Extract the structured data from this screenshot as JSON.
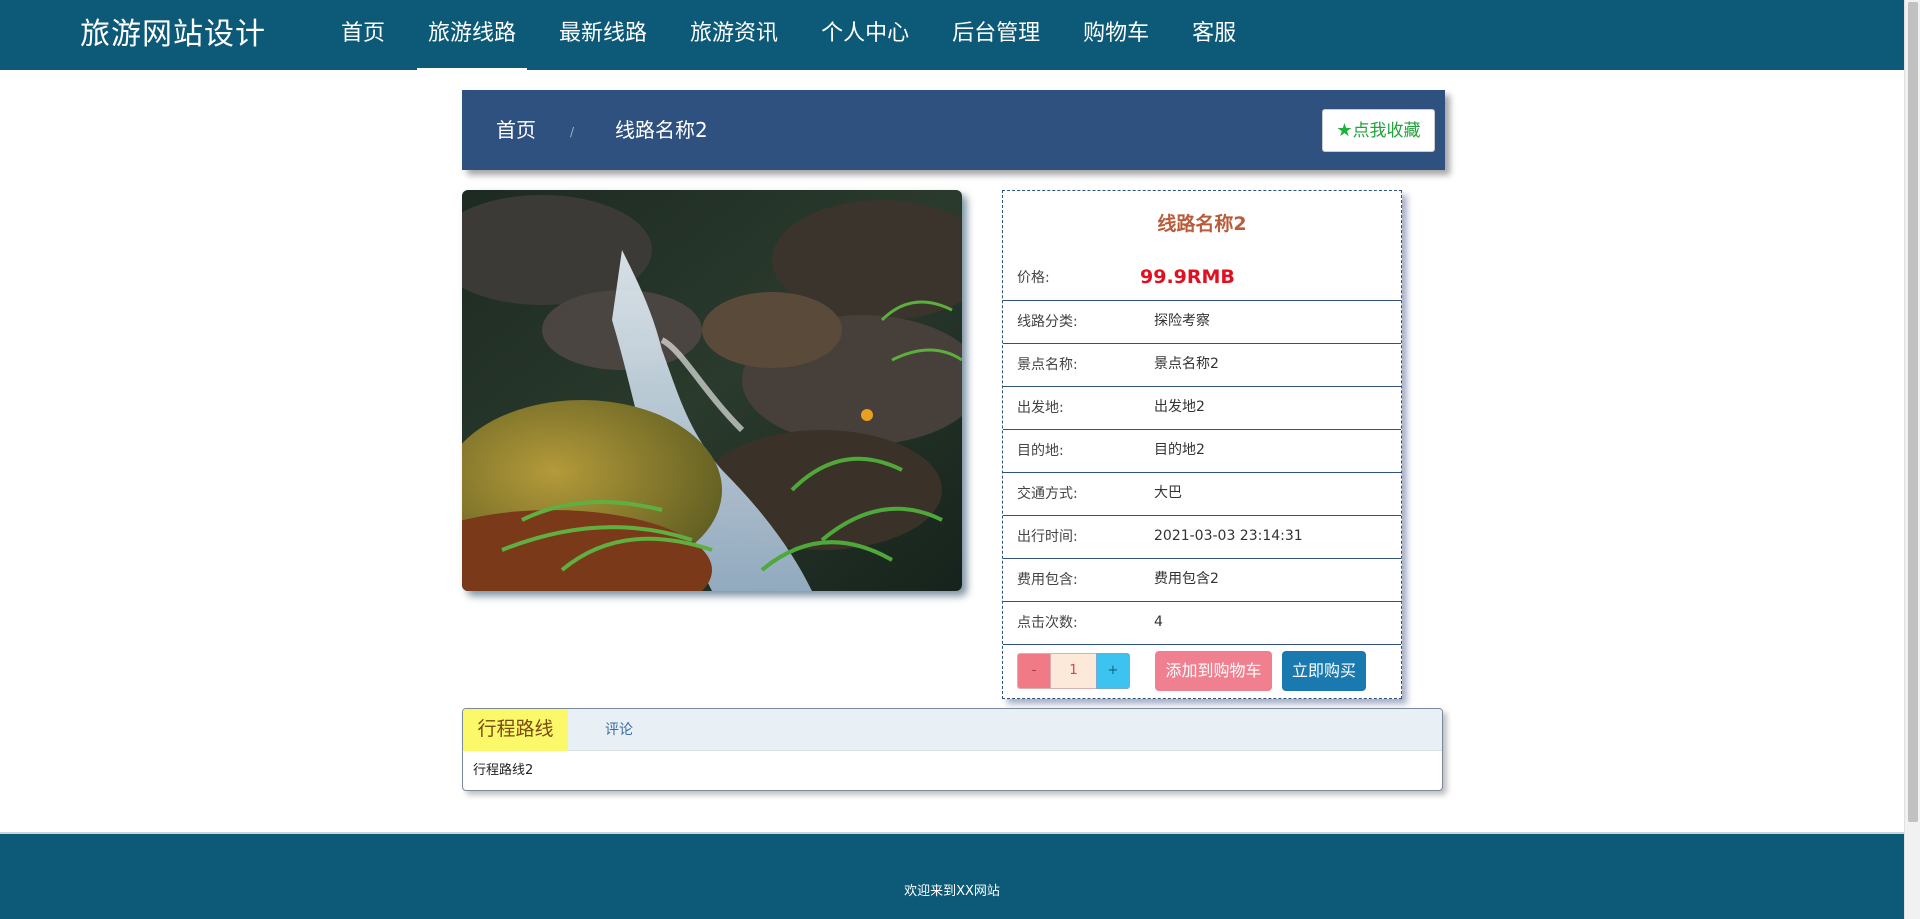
{
  "site": {
    "brand": "旅游网站设计"
  },
  "nav": {
    "items": [
      {
        "label": "首页",
        "active": false
      },
      {
        "label": "旅游线路",
        "active": true
      },
      {
        "label": "最新线路",
        "active": false
      },
      {
        "label": "旅游资讯",
        "active": false
      },
      {
        "label": "个人中心",
        "active": false
      },
      {
        "label": "后台管理",
        "active": false
      },
      {
        "label": "购物车",
        "active": false
      },
      {
        "label": "客服",
        "active": false
      }
    ]
  },
  "breadcrumb": {
    "home": "首页",
    "separator": "/",
    "current": "线路名称2"
  },
  "favorite": {
    "label": "点我收藏"
  },
  "product": {
    "title": "线路名称2",
    "price_label": "价格:",
    "price": "99.9RMB",
    "fields": [
      {
        "key": "线路分类:",
        "value": "探险考察"
      },
      {
        "key": "景点名称:",
        "value": "景点名称2"
      },
      {
        "key": "出发地:",
        "value": "出发地2"
      },
      {
        "key": "目的地:",
        "value": "目的地2"
      },
      {
        "key": "交通方式:",
        "value": "大巴"
      },
      {
        "key": "出行时间:",
        "value": "2021-03-03 23:14:31"
      },
      {
        "key": "费用包含:",
        "value": "费用包含2"
      },
      {
        "key": "点击次数:",
        "value": "4"
      }
    ]
  },
  "purchase": {
    "minus": "-",
    "quantity": "1",
    "plus": "+",
    "add_to_cart": "添加到购物车",
    "buy_now": "立即购买"
  },
  "tabs": {
    "active_label": "行程路线",
    "other_label": "评论",
    "content": "行程路线2"
  },
  "footer": {
    "text": "欢迎来到XX网站"
  },
  "colors": {
    "nav_bg": "#0c5a78",
    "breadcrumb_bg": "#2f5180",
    "price": "#e01020",
    "title": "#b85c3c",
    "cart_btn": "#f08090",
    "buy_btn": "#1a7ab0"
  },
  "icons": {
    "favorite": "star-icon"
  }
}
